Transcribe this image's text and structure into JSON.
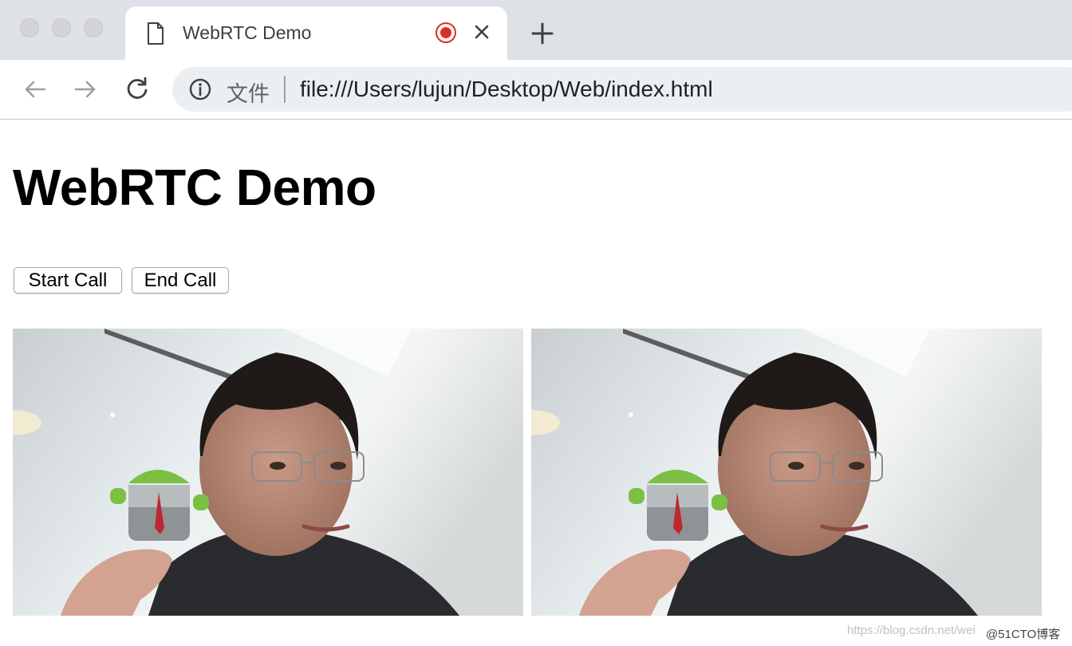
{
  "browser": {
    "tab": {
      "title": "WebRTC Demo"
    },
    "address_bar": {
      "scheme_label": "文件",
      "url": "file:///Users/lujun/Desktop/Web/index.html"
    },
    "icons": [
      "page-icon",
      "recording-icon",
      "close-icon",
      "new-tab-icon",
      "back-icon",
      "forward-icon",
      "reload-icon",
      "info-icon"
    ]
  },
  "page": {
    "title": "WebRTC Demo",
    "buttons": {
      "start_call": "Start Call",
      "end_call": "End Call"
    },
    "videos": [
      {
        "role": "local-video"
      },
      {
        "role": "remote-video"
      }
    ]
  },
  "watermark": {
    "url_text": "https://blog.csdn.net/wei",
    "brand_text": "@51CTO博客"
  },
  "colors": {
    "recording": "#d93025",
    "tabstrip": "#dee1e6",
    "omnibox": "#eceff1"
  }
}
